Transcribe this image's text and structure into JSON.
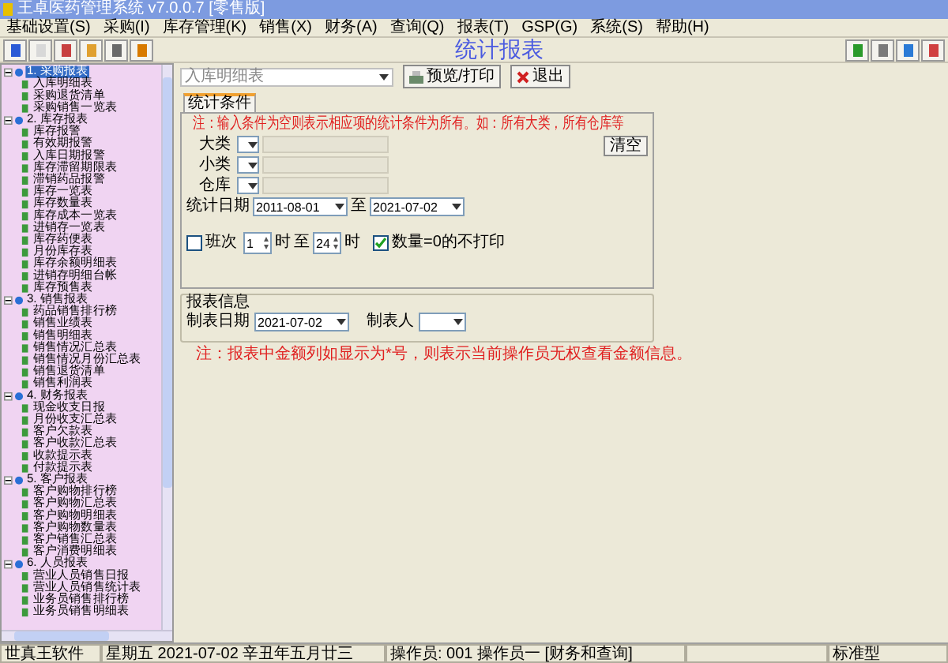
{
  "window": {
    "title": "王卓医药管理系统 v7.0.0.7 [零售版]"
  },
  "menu": [
    "基础设置(S)",
    "采购(I)",
    "库存管理(K)",
    "销售(X)",
    "财务(A)",
    "查询(Q)",
    "报表(T)",
    "GSP(G)",
    "系统(S)",
    "帮助(H)"
  ],
  "report_title": "统计报表",
  "sidebar": {
    "items": [
      {
        "label": "1. 采购报表",
        "selected": true,
        "expanded": true,
        "children": [
          {
            "label": "入库明细表",
            "selected": false
          },
          {
            "label": "采购退货清单",
            "selected": false
          },
          {
            "label": "采购销售一览表",
            "selected": false
          }
        ]
      },
      {
        "label": "2. 库存报表",
        "selected": false,
        "expanded": true,
        "children": [
          {
            "label": "库存报警",
            "selected": false
          },
          {
            "label": "有效期报警",
            "selected": false
          },
          {
            "label": "入库日期报警",
            "selected": false
          },
          {
            "label": "库存滞留期限表",
            "selected": false
          },
          {
            "label": "滞销药品报警",
            "selected": false
          },
          {
            "label": "库存一览表",
            "selected": false
          },
          {
            "label": "库存数量表",
            "selected": false
          },
          {
            "label": "库存成本一览表",
            "selected": false
          },
          {
            "label": "进销存一览表",
            "selected": false
          },
          {
            "label": "库存药便表",
            "selected": false
          },
          {
            "label": "月份库存表",
            "selected": false
          },
          {
            "label": "库存余额明细表",
            "selected": false
          },
          {
            "label": "进销存明细台帐",
            "selected": false
          },
          {
            "label": "库存预售表",
            "selected": false
          }
        ]
      },
      {
        "label": "3. 销售报表",
        "selected": false,
        "expanded": true,
        "children": [
          {
            "label": "药品销售排行榜",
            "selected": false
          },
          {
            "label": "销售业绩表",
            "selected": false
          },
          {
            "label": "销售明细表",
            "selected": false
          },
          {
            "label": "销售情况汇总表",
            "selected": false
          },
          {
            "label": "销售情况月份汇总表",
            "selected": false
          },
          {
            "label": "销售退货清单",
            "selected": false
          },
          {
            "label": "销售利润表",
            "selected": false
          }
        ]
      },
      {
        "label": "4. 财务报表",
        "selected": false,
        "expanded": true,
        "children": [
          {
            "label": "现金收支日报",
            "selected": false
          },
          {
            "label": "月份收支汇总表",
            "selected": false
          },
          {
            "label": "客户欠款表",
            "selected": false
          },
          {
            "label": "客户收款汇总表",
            "selected": false
          },
          {
            "label": "收款提示表",
            "selected": false
          },
          {
            "label": "付款提示表",
            "selected": false
          }
        ]
      },
      {
        "label": "5. 客户报表",
        "selected": false,
        "expanded": true,
        "children": [
          {
            "label": "客户购物排行榜",
            "selected": false
          },
          {
            "label": "客户购物汇总表",
            "selected": false
          },
          {
            "label": "客户购物明细表",
            "selected": false
          },
          {
            "label": "客户购物数量表",
            "selected": false
          },
          {
            "label": "客户销售汇总表",
            "selected": false
          },
          {
            "label": "客户消费明细表",
            "selected": false
          }
        ]
      },
      {
        "label": "6. 人员报表",
        "selected": false,
        "expanded": true,
        "children": [
          {
            "label": "营业人员销售日报",
            "selected": false
          },
          {
            "label": "营业人员销售统计表",
            "selected": false
          },
          {
            "label": "业务员销售排行榜",
            "selected": false
          },
          {
            "label": "业务员销售明细表",
            "selected": false
          }
        ]
      }
    ]
  },
  "report_selector": {
    "value": "入库明细表"
  },
  "buttons": [
    {
      "label": "预览/打印",
      "kind": "print"
    },
    {
      "label": "退出",
      "kind": "exit"
    }
  ],
  "criteria": {
    "tab": "统计条件",
    "note": "注：输入条件为空则表示相应项的统计条件为所有。如：所有大类，所有仓库等",
    "clear_button": "清空",
    "fields": [
      {
        "label": "大类"
      },
      {
        "label": "小类"
      },
      {
        "label": "仓库"
      }
    ],
    "date": {
      "label": "统计日期",
      "from": "2011-08-01",
      "to_label": "至",
      "to": "2021-07-02"
    },
    "shift": {
      "label": "班次",
      "checked": false,
      "from": "1",
      "unit1": "时",
      "to_label": "至",
      "to": "24",
      "unit2": "时"
    },
    "skip_zero": {
      "label": "数量=0的不打印",
      "checked": true
    }
  },
  "report_info": {
    "title": "报表信息",
    "date_label": "制表日期",
    "date": "2021-07-02",
    "maker_label": "制表人"
  },
  "footer_note": "注：报表中金额列如显示为*号，则表示当前操作员无权查看金额信息。",
  "status_bar": [
    "世真王软件",
    "星期五 2021-07-02 辛丑年五月廿三",
    "操作员: 001 操作员一 [财务和查询]",
    "标准型"
  ]
}
